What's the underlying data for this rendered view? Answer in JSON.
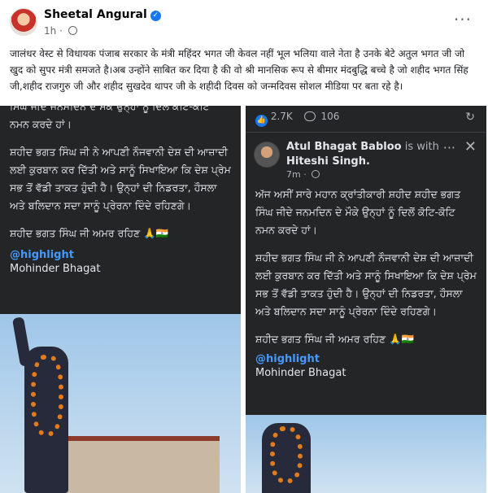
{
  "post": {
    "author": "Sheetal Angural",
    "time": "1h",
    "meta_sep": "·",
    "more": "···",
    "text": "जालंधर वेस्ट से विधायक पंजाब सरकार के मंत्री महिंदर भगत जी केवल नहीं भूल भलिया वाले नेता है उनके बेटे अतुल भगत जी जो खुद को सुपर मंत्री समजते है।अब उन्होंने साबित कर दिया है की वो श्री मानसिक रूप से बीमार मंदबुद्धि बच्चे है जो शहीद भगत सिंह जी,शहीद राजगुरु जी और शहीद सुखदेव थापर जी के शहीदी दिवस को जन्मदिवस सोशल मीडिया पर बता रहे है।"
  },
  "left": {
    "partial_line": "ਸਿੰਘ ਜੀਦੇ ਜਨਮਦਿਨ ਦੇ ਮੌਕੇ ਉਨ੍ਹਾਂ ਨੂੰ ਦਿਲੋਂ ਕੋਟਿ-ਕੋਟਿ",
    "line_end": "ਨਮਨ ਕਰਦੇ ਹਾਂ।",
    "para2": "ਸ਼ਹੀਦ ਭਗਤ ਸਿੰਘ ਜੀ ਨੇ ਆਪਣੀ ਨੌਜਵਾਨੀ ਦੇਸ਼ ਦੀ ਆਜ਼ਾਦੀ ਲਈ ਕੁਰਬਾਨ ਕਰ ਦਿੱਤੀ ਅਤੇ ਸਾਨੂੰ ਸਿਖਾਇਆ ਕਿ ਦੇਸ਼ ਪ੍ਰੇਮ ਸਭ ਤੋਂ ਵੱਡੀ ਤਾਕਤ ਹੁੰਦੀ ਹੈ। ਉਨ੍ਹਾਂ ਦੀ ਨਿਡਰਤਾ, ਹੌਸਲਾ ਅਤੇ ਬਲਿਦਾਨ ਸਦਾ ਸਾਨੂੰ ਪ੍ਰੇਰਨਾ ਦਿੰਦੇ ਰਹਿਣਗੇ।",
    "para3": "ਸ਼ਹੀਦ ਭਗਤ ਸਿੰਘ ਜੀ ਅਮਰ ਰਹਿਣ 🙏🇮🇳",
    "highlight": "@highlight",
    "signature": "Mohinder Bhagat"
  },
  "right": {
    "likes": "2.7K",
    "comments": "106",
    "share_icon": "↻",
    "author": "Atul Bhagat Babloo",
    "is_with": "is with",
    "tagged": "Hiteshi Singh.",
    "time": "7m",
    "more": "···",
    "close": "✕",
    "para1": "ਅੱਜ ਅਸੀਂ ਸਾਰੇ ਮਹਾਨ ਕ੍ਰਾਂਤੀਕਾਰੀ ਸ਼ਹੀਦ ਸ਼ਹੀਦ ਭਗਤ ਸਿੰਘ ਜੀਦੇ ਜਨਮਦਿਨ ਦੇ ਮੌਕੇ ਉਨ੍ਹਾਂ ਨੂੰ ਦਿਲੋਂ ਕੋਟਿ-ਕੋਟਿ ਨਮਨ ਕਰਦੇ ਹਾਂ।",
    "para2": "ਸ਼ਹੀਦ ਭਗਤ ਸਿੰਘ ਜੀ ਨੇ ਆਪਣੀ ਨੌਜਵਾਨੀ ਦੇਸ਼ ਦੀ ਆਜ਼ਾਦੀ ਲਈ ਕੁਰਬਾਨ ਕਰ ਦਿੱਤੀ ਅਤੇ ਸਾਨੂੰ ਸਿਖਾਇਆ ਕਿ ਦੇਸ਼ ਪ੍ਰੇਮ ਸਭ ਤੋਂ ਵੱਡੀ ਤਾਕਤ ਹੁੰਦੀ ਹੈ। ਉਨ੍ਹਾਂ ਦੀ ਨਿਡਰਤਾ, ਹੌਸਲਾ ਅਤੇ ਬਲਿਦਾਨ ਸਦਾ ਸਾਨੂੰ ਪ੍ਰੇਰਨਾ ਦਿੰਦੇ ਰਹਿਣਗੇ।",
    "para3": "ਸ਼ਹੀਦ ਭਗਤ ਸਿੰਘ ਜੀ ਅਮਰ ਰਹਿਣ 🙏🇮🇳",
    "highlight": "@highlight",
    "signature": "Mohinder Bhagat"
  },
  "colors": {
    "dark_bg": "#242526",
    "link_blue": "#4599ff",
    "fb_blue": "#1877f2"
  }
}
